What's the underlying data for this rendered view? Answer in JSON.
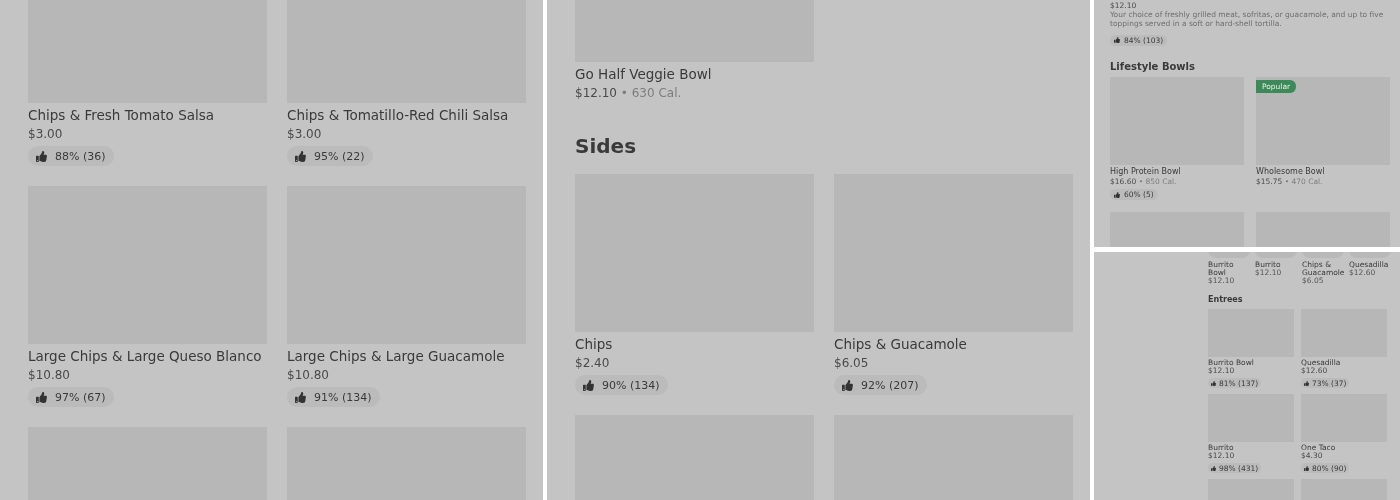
{
  "panel_1": {
    "items": [
      {
        "name": "Chips & Fresh Tomato Salsa",
        "price": "$3.00",
        "rating": "88% (36)"
      },
      {
        "name": "Chips & Tomatillo-Red Chili Salsa",
        "price": "$3.00",
        "rating": "95% (22)"
      },
      {
        "name": "Large Chips & Large Queso Blanco",
        "price": "$10.80",
        "rating": "97% (67)"
      },
      {
        "name": "Large Chips & Large Guacamole",
        "price": "$10.80",
        "rating": "91% (134)"
      }
    ]
  },
  "panel_2": {
    "items": [
      {
        "name": "Go Half Veggie Bowl",
        "price": "$12.10",
        "calories": "• 630 Cal."
      }
    ],
    "sections": [
      {
        "title": "Sides",
        "items": [
          {
            "name": "Chips",
            "price": "$2.40",
            "rating": "90% (134)"
          },
          {
            "name": "Chips & Guacamole",
            "price": "$6.05",
            "rating": "92% (207)"
          }
        ]
      }
    ]
  },
  "panel_3": {
    "item": {
      "price": "$12.10",
      "description": "Your choice of freshly grilled meat, sofritas, or guacamole, and up to five toppings served in a soft or hard-shell tortilla.",
      "rating": "84% (103)"
    },
    "sections": [
      {
        "title": "Lifestyle Bowls",
        "items": [
          {
            "name": "High Protein Bowl",
            "price": "$16.60",
            "calories": "• 850 Cal.",
            "rating": "60% (5)"
          },
          {
            "name": "Wholesome Bowl",
            "price": "$15.75",
            "calories": "• 470 Cal.",
            "badge": "Popular"
          }
        ]
      }
    ]
  },
  "panel_4": {
    "featured": [
      {
        "name": "Burrito Bowl",
        "price": "$12.10"
      },
      {
        "name": "Burrito",
        "price": "$12.10"
      },
      {
        "name": "Chips & Guacamole",
        "price": "$6.05"
      },
      {
        "name": "Quesadilla",
        "price": "$12.60"
      }
    ],
    "sections": [
      {
        "title": "Entrees",
        "items": [
          {
            "name": "Burrito Bowl",
            "price": "$12.10",
            "rating": "81% (137)"
          },
          {
            "name": "Quesadilla",
            "price": "$12.60",
            "rating": "73% (37)"
          },
          {
            "name": "Burrito",
            "price": "$12.10",
            "rating": "98% (431)"
          },
          {
            "name": "One Taco",
            "price": "$4.30",
            "rating": "80% (90)"
          }
        ]
      }
    ]
  }
}
